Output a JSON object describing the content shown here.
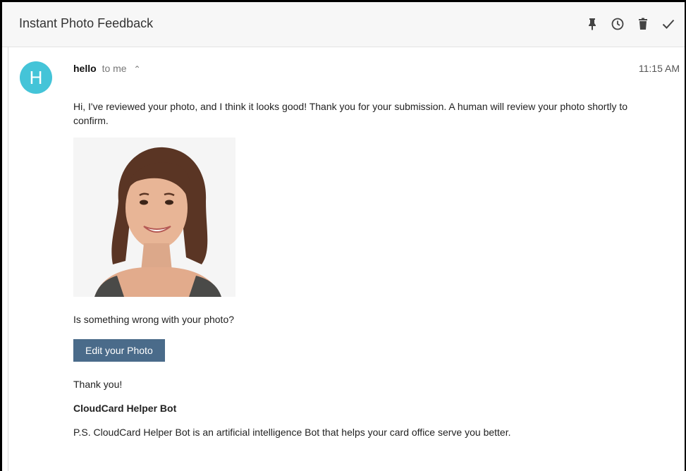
{
  "header": {
    "subject": "Instant Photo Feedback",
    "actions": {
      "pin_icon": "pin-icon",
      "snooze_icon": "clock-icon",
      "trash_icon": "trash-icon",
      "done_icon": "check-icon"
    }
  },
  "message": {
    "avatar_letter": "H",
    "avatar_color": "#44c4d8",
    "sender": "hello",
    "recipient": "to me",
    "time": "11:15 AM",
    "intro": "Hi, I've reviewed your photo, and I think it looks good! Thank you for your submission. A human will review your photo shortly to confirm.",
    "question": "Is something wrong with your photo?",
    "button_label": "Edit your Photo",
    "button_color": "#4a6b8a",
    "thanks": "Thank you!",
    "signature": "CloudCard Helper Bot",
    "ps": "P.S. CloudCard Helper Bot is an artificial intelligence Bot that helps your card office serve you better."
  }
}
